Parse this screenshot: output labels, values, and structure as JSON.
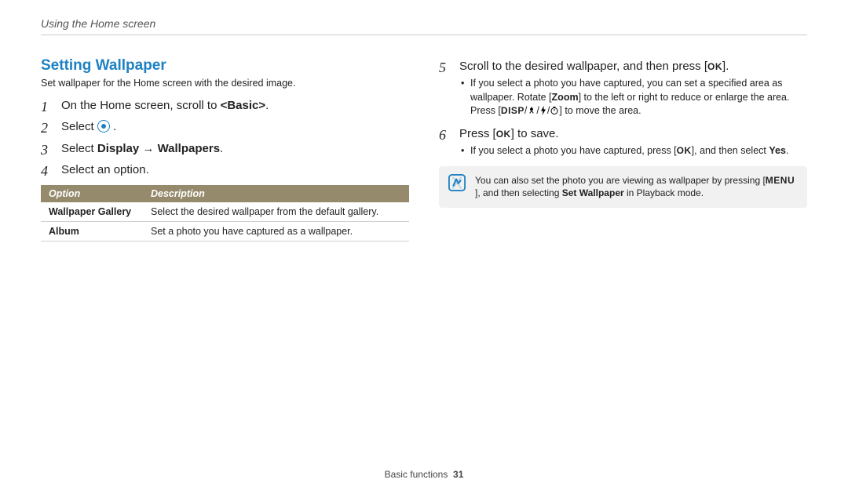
{
  "header": {
    "breadcrumb": "Using the Home screen"
  },
  "left": {
    "title": "Setting Wallpaper",
    "intro": "Set wallpaper for the Home screen with the desired image.",
    "steps": {
      "s1_pre": "On the Home screen, scroll to ",
      "s1_bold": "<Basic>",
      "s1_post": ".",
      "s2_pre": "Select ",
      "s2_post": " .",
      "s3_pre": "Select ",
      "s3_b1": "Display",
      "s3_arrow": " → ",
      "s3_b2": "Wallpapers",
      "s3_post": ".",
      "s4": "Select an option."
    },
    "table": {
      "h1": "Option",
      "h2": "Description",
      "rows": [
        {
          "opt": "Wallpaper Gallery",
          "desc": "Select the desired wallpaper from the default gallery."
        },
        {
          "opt": "Album",
          "desc": "Set a photo you have captured as a wallpaper."
        }
      ]
    }
  },
  "right": {
    "s5_pre": "Scroll to the desired wallpaper, and then press [",
    "s5_key": "OK",
    "s5_post": "].",
    "s5_sub_a": "If you select a photo you have captured, you can set a specified area as wallpaper. Rotate [",
    "s5_sub_zoom": "Zoom",
    "s5_sub_b": "] to the left or right to reduce or enlarge the area. Press [",
    "s5_sub_disp": "DISP",
    "s5_sub_slash1": "/",
    "s5_sub_slash2": "/",
    "s5_sub_slash3": "/",
    "s5_sub_c": "] to move the area.",
    "s6_pre": "Press [",
    "s6_key": "OK",
    "s6_post": "] to save.",
    "s6_sub_a": "If you select a photo you have captured, press [",
    "s6_sub_ok": "OK",
    "s6_sub_b": "], and then select ",
    "s6_sub_yes": "Yes",
    "s6_sub_c": ".",
    "note_a": "You can also set the photo you are viewing as wallpaper by pressing [",
    "note_menu": "MENU",
    "note_b": "], and then selecting ",
    "note_setwp": "Set Wallpaper",
    "note_c": " in Playback mode."
  },
  "footer": {
    "section": "Basic functions",
    "page": "31"
  }
}
